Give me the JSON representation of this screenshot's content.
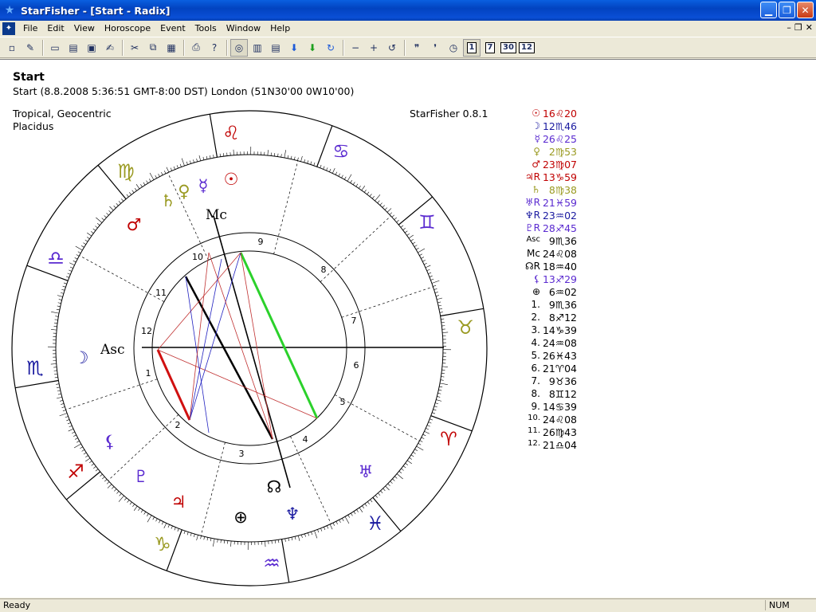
{
  "window": {
    "title": "StarFisher - [Start - Radix]"
  },
  "menu": [
    "File",
    "Edit",
    "View",
    "Horoscope",
    "Event",
    "Tools",
    "Window",
    "Help"
  ],
  "toolbar": {
    "boxes": [
      "1",
      "7",
      "30",
      "12"
    ]
  },
  "chart": {
    "title": "Start",
    "subtitle": "Start (8.8.2008 5:36:51 GMT-8:00 DST) London (51N30'00 0W10'00)",
    "system": "Tropical, Geocentric",
    "houses": "Placidus",
    "version": "StarFisher 0.8.1",
    "asc_label": "Asc",
    "mc_label": "Mc"
  },
  "zodiac": [
    {
      "glyph": "♌",
      "color": "#c00000"
    },
    {
      "glyph": "♋",
      "color": "#5a2ad0"
    },
    {
      "glyph": "♊",
      "color": "#5a2ad0"
    },
    {
      "glyph": "♉",
      "color": "#9a9a22"
    },
    {
      "glyph": "♈",
      "color": "#c00000"
    },
    {
      "glyph": "♓",
      "color": "#1a1aa0"
    },
    {
      "glyph": "♒",
      "color": "#5a2ad0"
    },
    {
      "glyph": "♑",
      "color": "#9a9a22"
    },
    {
      "glyph": "♐",
      "color": "#c00000"
    },
    {
      "glyph": "♏",
      "color": "#1a1aa0"
    },
    {
      "glyph": "♎",
      "color": "#5a2ad0"
    },
    {
      "glyph": "♍",
      "color": "#9a9a22"
    }
  ],
  "wheel_planets": [
    {
      "glyph": "☉",
      "color": "#c00000"
    },
    {
      "glyph": "☿",
      "color": "#5a2ad0"
    },
    {
      "glyph": "♀",
      "color": "#9a9a22"
    },
    {
      "glyph": "♄",
      "color": "#9a9a22"
    },
    {
      "glyph": "♂",
      "color": "#c00000"
    },
    {
      "glyph": "☽",
      "color": "#1a1aa0"
    },
    {
      "glyph": "⚸",
      "color": "#5a2ad0"
    },
    {
      "glyph": "♇",
      "color": "#5a2ad0"
    },
    {
      "glyph": "♃",
      "color": "#c00000"
    },
    {
      "glyph": "⊕",
      "color": "#000000"
    },
    {
      "glyph": "☊",
      "color": "#000000"
    },
    {
      "glyph": "♆",
      "color": "#1a1aa0"
    },
    {
      "glyph": "♅",
      "color": "#5a2ad0"
    }
  ],
  "house_numbers": [
    "1",
    "2",
    "3",
    "4",
    "5",
    "6",
    "7",
    "8",
    "9",
    "10",
    "11",
    "12"
  ],
  "positions": [
    {
      "sym": "☉",
      "val": "16♌20",
      "color": "#c00000"
    },
    {
      "sym": "☽",
      "val": "12♏46",
      "color": "#1a1aa0"
    },
    {
      "sym": "☿",
      "val": "26♌25",
      "color": "#5a2ad0"
    },
    {
      "sym": "♀",
      "val": "2♍53",
      "color": "#9a9a22"
    },
    {
      "sym": "♂",
      "val": "23♍07",
      "color": "#c00000"
    },
    {
      "sym": "♃R",
      "val": "13♑59",
      "color": "#c00000"
    },
    {
      "sym": "♄",
      "val": "8♍38",
      "color": "#9a9a22"
    },
    {
      "sym": "♅R",
      "val": "21♓59",
      "color": "#5a2ad0"
    },
    {
      "sym": "♆R",
      "val": "23♒02",
      "color": "#1a1aa0"
    },
    {
      "sym": "♇R",
      "val": "28♐45",
      "color": "#5a2ad0"
    },
    {
      "sym": "Asc",
      "val": "9♏36",
      "color": "#000000"
    },
    {
      "sym": "Mc",
      "val": "24♌08",
      "color": "#000000"
    },
    {
      "sym": "☊R",
      "val": "18♒40",
      "color": "#000000"
    },
    {
      "sym": "⚸",
      "val": "13♐29",
      "color": "#5a2ad0"
    },
    {
      "sym": "⊕",
      "val": "6♒02",
      "color": "#000000"
    },
    {
      "sym": "1.",
      "val": "9♏36",
      "color": "#000000"
    },
    {
      "sym": "2.",
      "val": "8♐12",
      "color": "#000000"
    },
    {
      "sym": "3.",
      "val": "14♑39",
      "color": "#000000"
    },
    {
      "sym": "4.",
      "val": "24♒08",
      "color": "#000000"
    },
    {
      "sym": "5.",
      "val": "26♓43",
      "color": "#000000"
    },
    {
      "sym": "6.",
      "val": "21♈04",
      "color": "#000000"
    },
    {
      "sym": "7.",
      "val": "9♉36",
      "color": "#000000"
    },
    {
      "sym": "8.",
      "val": "8♊12",
      "color": "#000000"
    },
    {
      "sym": "9.",
      "val": "14♋39",
      "color": "#000000"
    },
    {
      "sym": "10.",
      "val": "24♌08",
      "color": "#000000"
    },
    {
      "sym": "11.",
      "val": "26♍43",
      "color": "#000000"
    },
    {
      "sym": "12.",
      "val": "21♎04",
      "color": "#000000"
    }
  ],
  "status": {
    "left": "Ready",
    "num": "NUM"
  }
}
